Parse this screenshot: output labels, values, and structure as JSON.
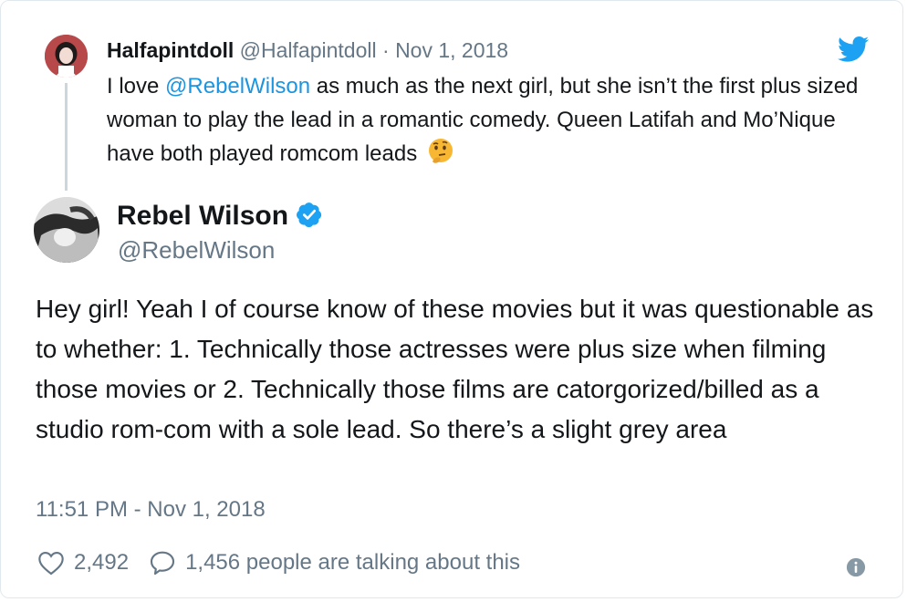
{
  "parent_tweet": {
    "display_name": "Halfapintdoll",
    "handle": "@Halfapintdoll",
    "separator": "·",
    "date": "Nov 1, 2018",
    "text_before": "I love ",
    "mention": "@RebelWilson",
    "text_after": " as much as the next girl, but she isn’t the first plus sized woman to play the lead in a romantic comedy. Queen Latifah and Mo’Nique have both played romcom leads",
    "emoji": "thinking-face-icon"
  },
  "main_tweet": {
    "display_name": "Rebel Wilson",
    "handle": "@RebelWilson",
    "text": "Hey girl! Yeah I of course know of these movies but it was questionable as to whether: 1. Technically those actresses were plus size when filming those movies or 2. Technically those films are catorgorized/billed as a studio rom-com with a sole lead. So there’s a slight grey area",
    "timestamp": "11:51 PM - Nov 1, 2018",
    "like_count": "2,492",
    "talking": "1,456 people are talking about this"
  },
  "colors": {
    "link": "#1b95e0",
    "secondary_text": "#657786",
    "twitter_blue": "#1da1f2",
    "verified_blue": "#1da1f2"
  }
}
